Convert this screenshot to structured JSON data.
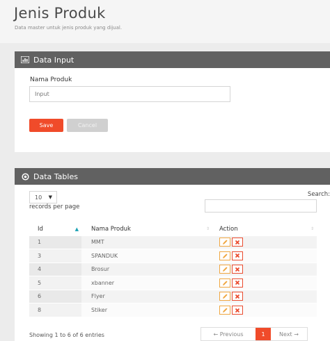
{
  "header": {
    "title": "Jenis Produk",
    "subtitle": "Data master untuk jenis produk yang dijual."
  },
  "input_panel": {
    "title": "Data Input",
    "icon": "chart-icon",
    "field_label": "Nama Produk",
    "field_placeholder": "Input",
    "save_label": "Save",
    "cancel_label": "Cancel"
  },
  "table_panel": {
    "title": "Data Tables",
    "icon": "circle-dot-icon",
    "page_length": "10",
    "records_text": "records per page",
    "search_label": "Search:",
    "columns": [
      "Id",
      "Nama Produk",
      "Action"
    ],
    "rows": [
      {
        "id": "1",
        "name": "MMT"
      },
      {
        "id": "3",
        "name": "SPANDUK"
      },
      {
        "id": "4",
        "name": "Brosur"
      },
      {
        "id": "5",
        "name": "xbanner"
      },
      {
        "id": "6",
        "name": "Flyer"
      },
      {
        "id": "8",
        "name": "Stiker"
      }
    ],
    "info": "Showing 1 to 6 of 6 entries",
    "pagination": {
      "prev": "← Previous",
      "current": "1",
      "next": "Next →"
    }
  },
  "colors": {
    "accent": "#f04b2a",
    "edit": "#f0a640",
    "delete": "#ea4b2e",
    "panel_header": "#616161"
  }
}
